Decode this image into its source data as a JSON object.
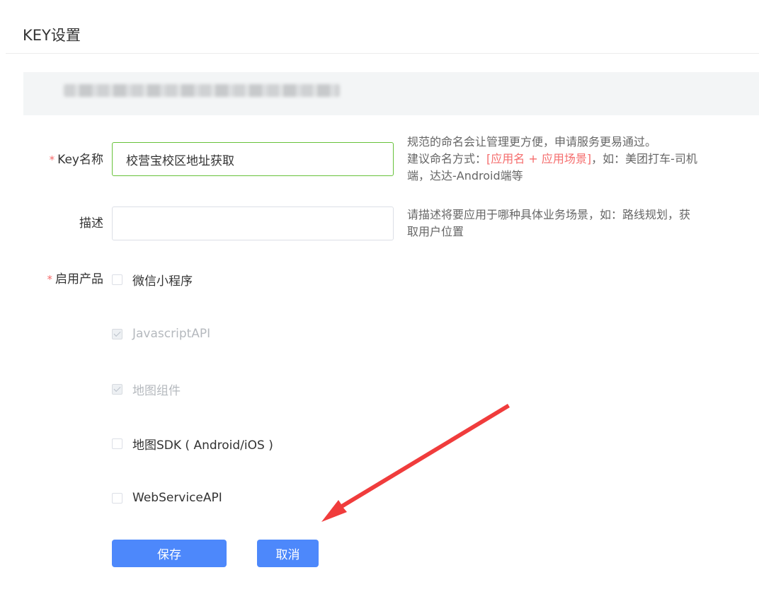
{
  "page": {
    "title": "KEY设置"
  },
  "form": {
    "key_name": {
      "label": "Key名称",
      "required_mark": "*",
      "value": "校营宝校区地址获取",
      "hint_line1": "规范的命名会让管理更方便，申请服务更易通过。",
      "hint_line2_prefix": "建议命名方式：",
      "hint_line2_highlight": "[应用名 + 应用场景]",
      "hint_line2_suffix": "，如：美团打车-司机",
      "hint_line3": "端，达达-Android端等"
    },
    "description": {
      "label": "描述",
      "value": "",
      "placeholder": "",
      "hint_line1": "请描述将要应用于哪种具体业务场景，如：路线规划，获",
      "hint_line2": "取用户位置"
    },
    "products": {
      "label": "启用产品",
      "required_mark": "*",
      "options": [
        {
          "label": "微信小程序",
          "checked": false,
          "disabled": false
        },
        {
          "label": "JavascriptAPI",
          "checked": true,
          "disabled": true
        },
        {
          "label": "地图组件",
          "checked": true,
          "disabled": true
        },
        {
          "label": "地图SDK ( Android/iOS )",
          "checked": false,
          "disabled": false
        },
        {
          "label": "WebServiceAPI",
          "checked": false,
          "disabled": false
        }
      ]
    }
  },
  "buttons": {
    "save": "保存",
    "cancel": "取消"
  },
  "colors": {
    "primary": "#4d88fb",
    "required": "#f56c6c",
    "focus_border": "#67c23a",
    "annotation_arrow": "#f03c3c"
  }
}
